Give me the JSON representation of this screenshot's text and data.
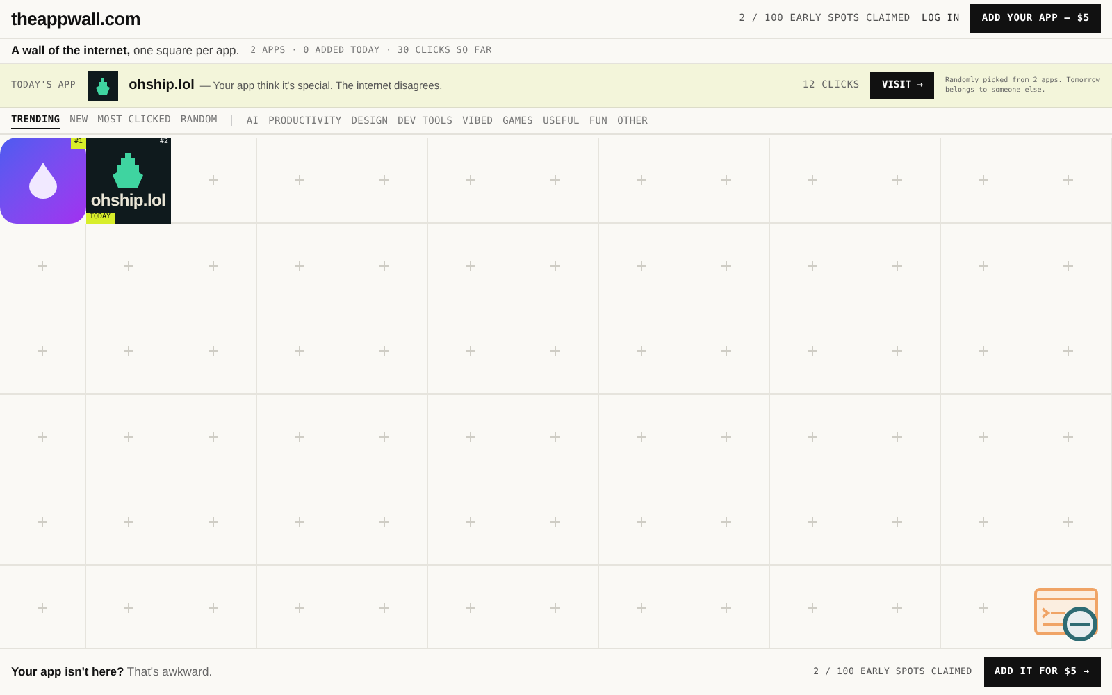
{
  "header": {
    "logo": "theappwall.com",
    "spots": "2 / 100 EARLY SPOTS CLAIMED",
    "login": "LOG IN",
    "cta": "ADD YOUR APP — $5"
  },
  "tagline": {
    "bold": "A wall of the internet,",
    "rest": "one square per app.",
    "stats": "2 APPS · 0 ADDED TODAY · 30 CLICKS SO FAR"
  },
  "todays_app": {
    "label": "TODAY'S APP",
    "name": "ohship.lol",
    "description": "— Your app think it's special. The internet disagrees.",
    "clicks": "12 CLICKS",
    "visit": "VISIT →",
    "note": "Randomly picked from 2 apps. Tomorrow belongs to someone else."
  },
  "tabs": [
    {
      "label": "TRENDING",
      "selected": true
    },
    {
      "label": "NEW",
      "selected": false
    },
    {
      "label": "MOST CLICKED",
      "selected": false
    },
    {
      "label": "RANDOM",
      "selected": false
    }
  ],
  "categories": [
    "AI",
    "PRODUCTIVITY",
    "DESIGN",
    "DEV TOOLS",
    "VIBED",
    "GAMES",
    "USEFUL",
    "FUN",
    "OTHER"
  ],
  "apps": [
    {
      "kind": "drop",
      "rank": "#1",
      "rank_highlighted": true
    },
    {
      "kind": "ship",
      "rank": "#2",
      "rank_highlighted": false,
      "logo_text": "ohship.lol",
      "today_label": "TODAY"
    }
  ],
  "footer": {
    "bold": "Your app isn't here?",
    "rest": "That's awkward.",
    "spots": "2 / 100 EARLY SPOTS CLAIMED",
    "cta": "ADD IT FOR $5 →"
  }
}
